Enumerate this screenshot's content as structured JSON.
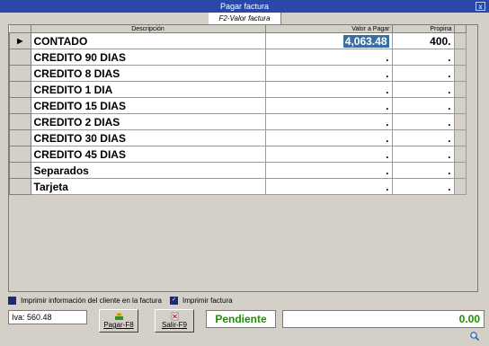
{
  "window": {
    "title": "Pagar factura",
    "close_label": "x"
  },
  "tab": {
    "label": "F2-Valor factura"
  },
  "grid": {
    "headers": {
      "descripcion": "Descripción",
      "valor": "Valor a Pagar",
      "propina": "Propina"
    },
    "rows": [
      {
        "indicator": "▶",
        "desc": "CONTADO",
        "valor": "4,063.48",
        "propina": "400."
      },
      {
        "indicator": "",
        "desc": "CREDITO 90 DIAS",
        "valor": ".",
        "propina": "."
      },
      {
        "indicator": "",
        "desc": "CREDITO 8 DIAS",
        "valor": ".",
        "propina": "."
      },
      {
        "indicator": "",
        "desc": "CREDITO 1 DIA",
        "valor": ".",
        "propina": "."
      },
      {
        "indicator": "",
        "desc": "CREDITO 15 DIAS",
        "valor": ".",
        "propina": "."
      },
      {
        "indicator": "",
        "desc": "CREDITO 2 DIAS",
        "valor": ".",
        "propina": "."
      },
      {
        "indicator": "",
        "desc": "CREDITO 30 DIAS",
        "valor": ".",
        "propina": "."
      },
      {
        "indicator": "",
        "desc": "CREDITO 45 DIAS",
        "valor": ".",
        "propina": "."
      },
      {
        "indicator": "",
        "desc": "Separados",
        "valor": ".",
        "propina": "."
      },
      {
        "indicator": "",
        "desc": "Tarjeta",
        "valor": ".",
        "propina": "."
      }
    ]
  },
  "options": {
    "print_client_info": {
      "label": "Imprimir información del cliente en la factura",
      "checked": false
    },
    "print_invoice": {
      "label": "Imprimir factura",
      "checked": true
    }
  },
  "footer": {
    "iva_text": "Iva: 560.48",
    "pay_button": "Pagar-F8",
    "exit_button": "Salir-F9",
    "status": "Pendiente",
    "amount": "0.00"
  },
  "colors": {
    "titlebar": "#2a48a8",
    "status_green": "#1d9000",
    "selection": "#3a6ea5"
  },
  "icons": {
    "pay": "money-icon",
    "exit": "exit-icon",
    "zoom": "magnifier-icon"
  }
}
